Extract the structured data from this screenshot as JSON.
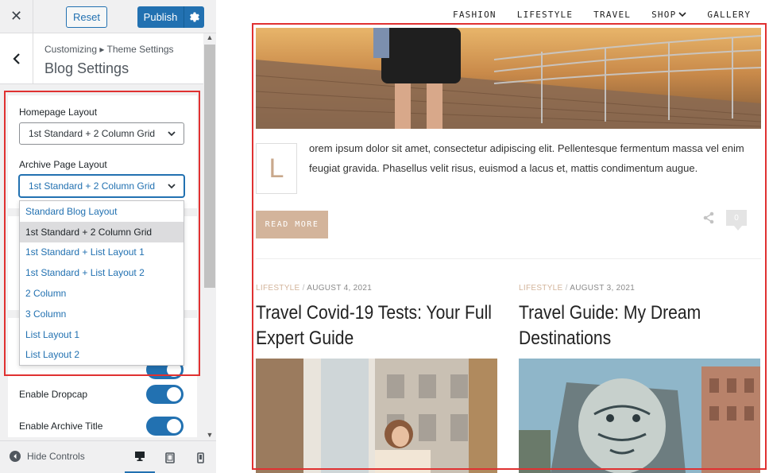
{
  "sidebar": {
    "close_glyph": "✕",
    "reset_label": "Reset",
    "publish_label": "Publish",
    "breadcrumb": "Customizing ▸ Theme Settings",
    "section_title": "Blog Settings",
    "homepage_layout": {
      "label": "Homepage Layout",
      "value": "1st Standard + 2 Column Grid"
    },
    "archive_layout": {
      "label": "Archive Page Layout",
      "value": "1st Standard + 2 Column Grid"
    },
    "dropdown_options": [
      "Standard Blog Layout",
      "1st Standard + 2 Column Grid",
      "1st Standard + List Layout 1",
      "1st Standard + List Layout 2",
      "2 Column",
      "3 Column",
      "List Layout 1",
      "List Layout 2"
    ],
    "selected_option_index": 1,
    "toggles": [
      {
        "label": "Enable Dropcap",
        "on": true
      },
      {
        "label": "Enable Archive Title",
        "on": true
      }
    ],
    "hide_controls_label": "Hide Controls",
    "accent_color": "#2271b1"
  },
  "preview": {
    "nav": [
      "FASHION",
      "LIFESTYLE",
      "TRAVEL",
      "SHOP",
      "GALLERY"
    ],
    "dropcap_letter": "L",
    "excerpt": "orem ipsum dolor sit amet, consectetur adipiscing elit. Pellentesque fermentum massa vel enim feugiat gravida. Phasellus velit risus, euismod a lacus et, mattis condimentum augue.",
    "read_more": "READ MORE",
    "comment_count": "0",
    "posts": [
      {
        "category": "LIFESTYLE",
        "date": "AUGUST 4, 2021",
        "title": "Travel Covid-19 Tests: Your Full Expert Guide"
      },
      {
        "category": "LIFESTYLE",
        "date": "AUGUST 3, 2021",
        "title": "Travel Guide: My Dream Destinations"
      }
    ],
    "meta_separator": "/",
    "accent_color": "#d3b49b"
  }
}
